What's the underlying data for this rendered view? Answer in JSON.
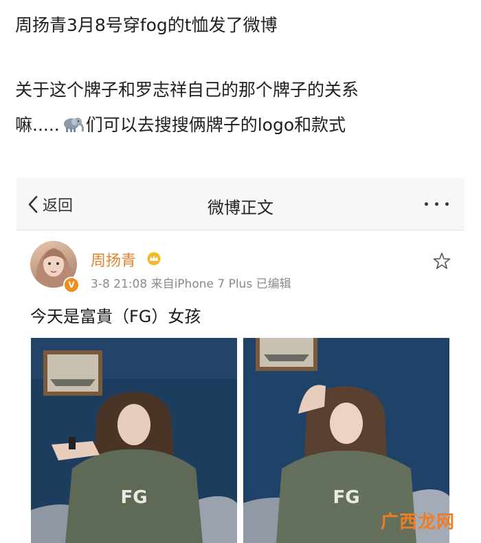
{
  "intro": {
    "line1": "周扬青3月8号穿fog的t恤发了微博",
    "line2": "关于这个牌子和罗志祥自己的那个牌子的关系",
    "line3_a": "嘛.....",
    "line3_b": "们可以去搜搜俩牌子的logo和款式"
  },
  "nav": {
    "back_label": "返回",
    "title": "微博正文"
  },
  "post": {
    "user_name": "周扬青",
    "verified_badge": "V",
    "meta": "3-8 21:08  来自iPhone 7 Plus  已编辑",
    "text": "今天是富貴（FG）女孩",
    "shirt_print_1": "FG",
    "shirt_print_2": "FG"
  },
  "watermark": {
    "text": "广西龙网"
  },
  "colors": {
    "accent": "#e3832d",
    "badge": "#f28d1b",
    "watermark": "#ef7d26"
  }
}
